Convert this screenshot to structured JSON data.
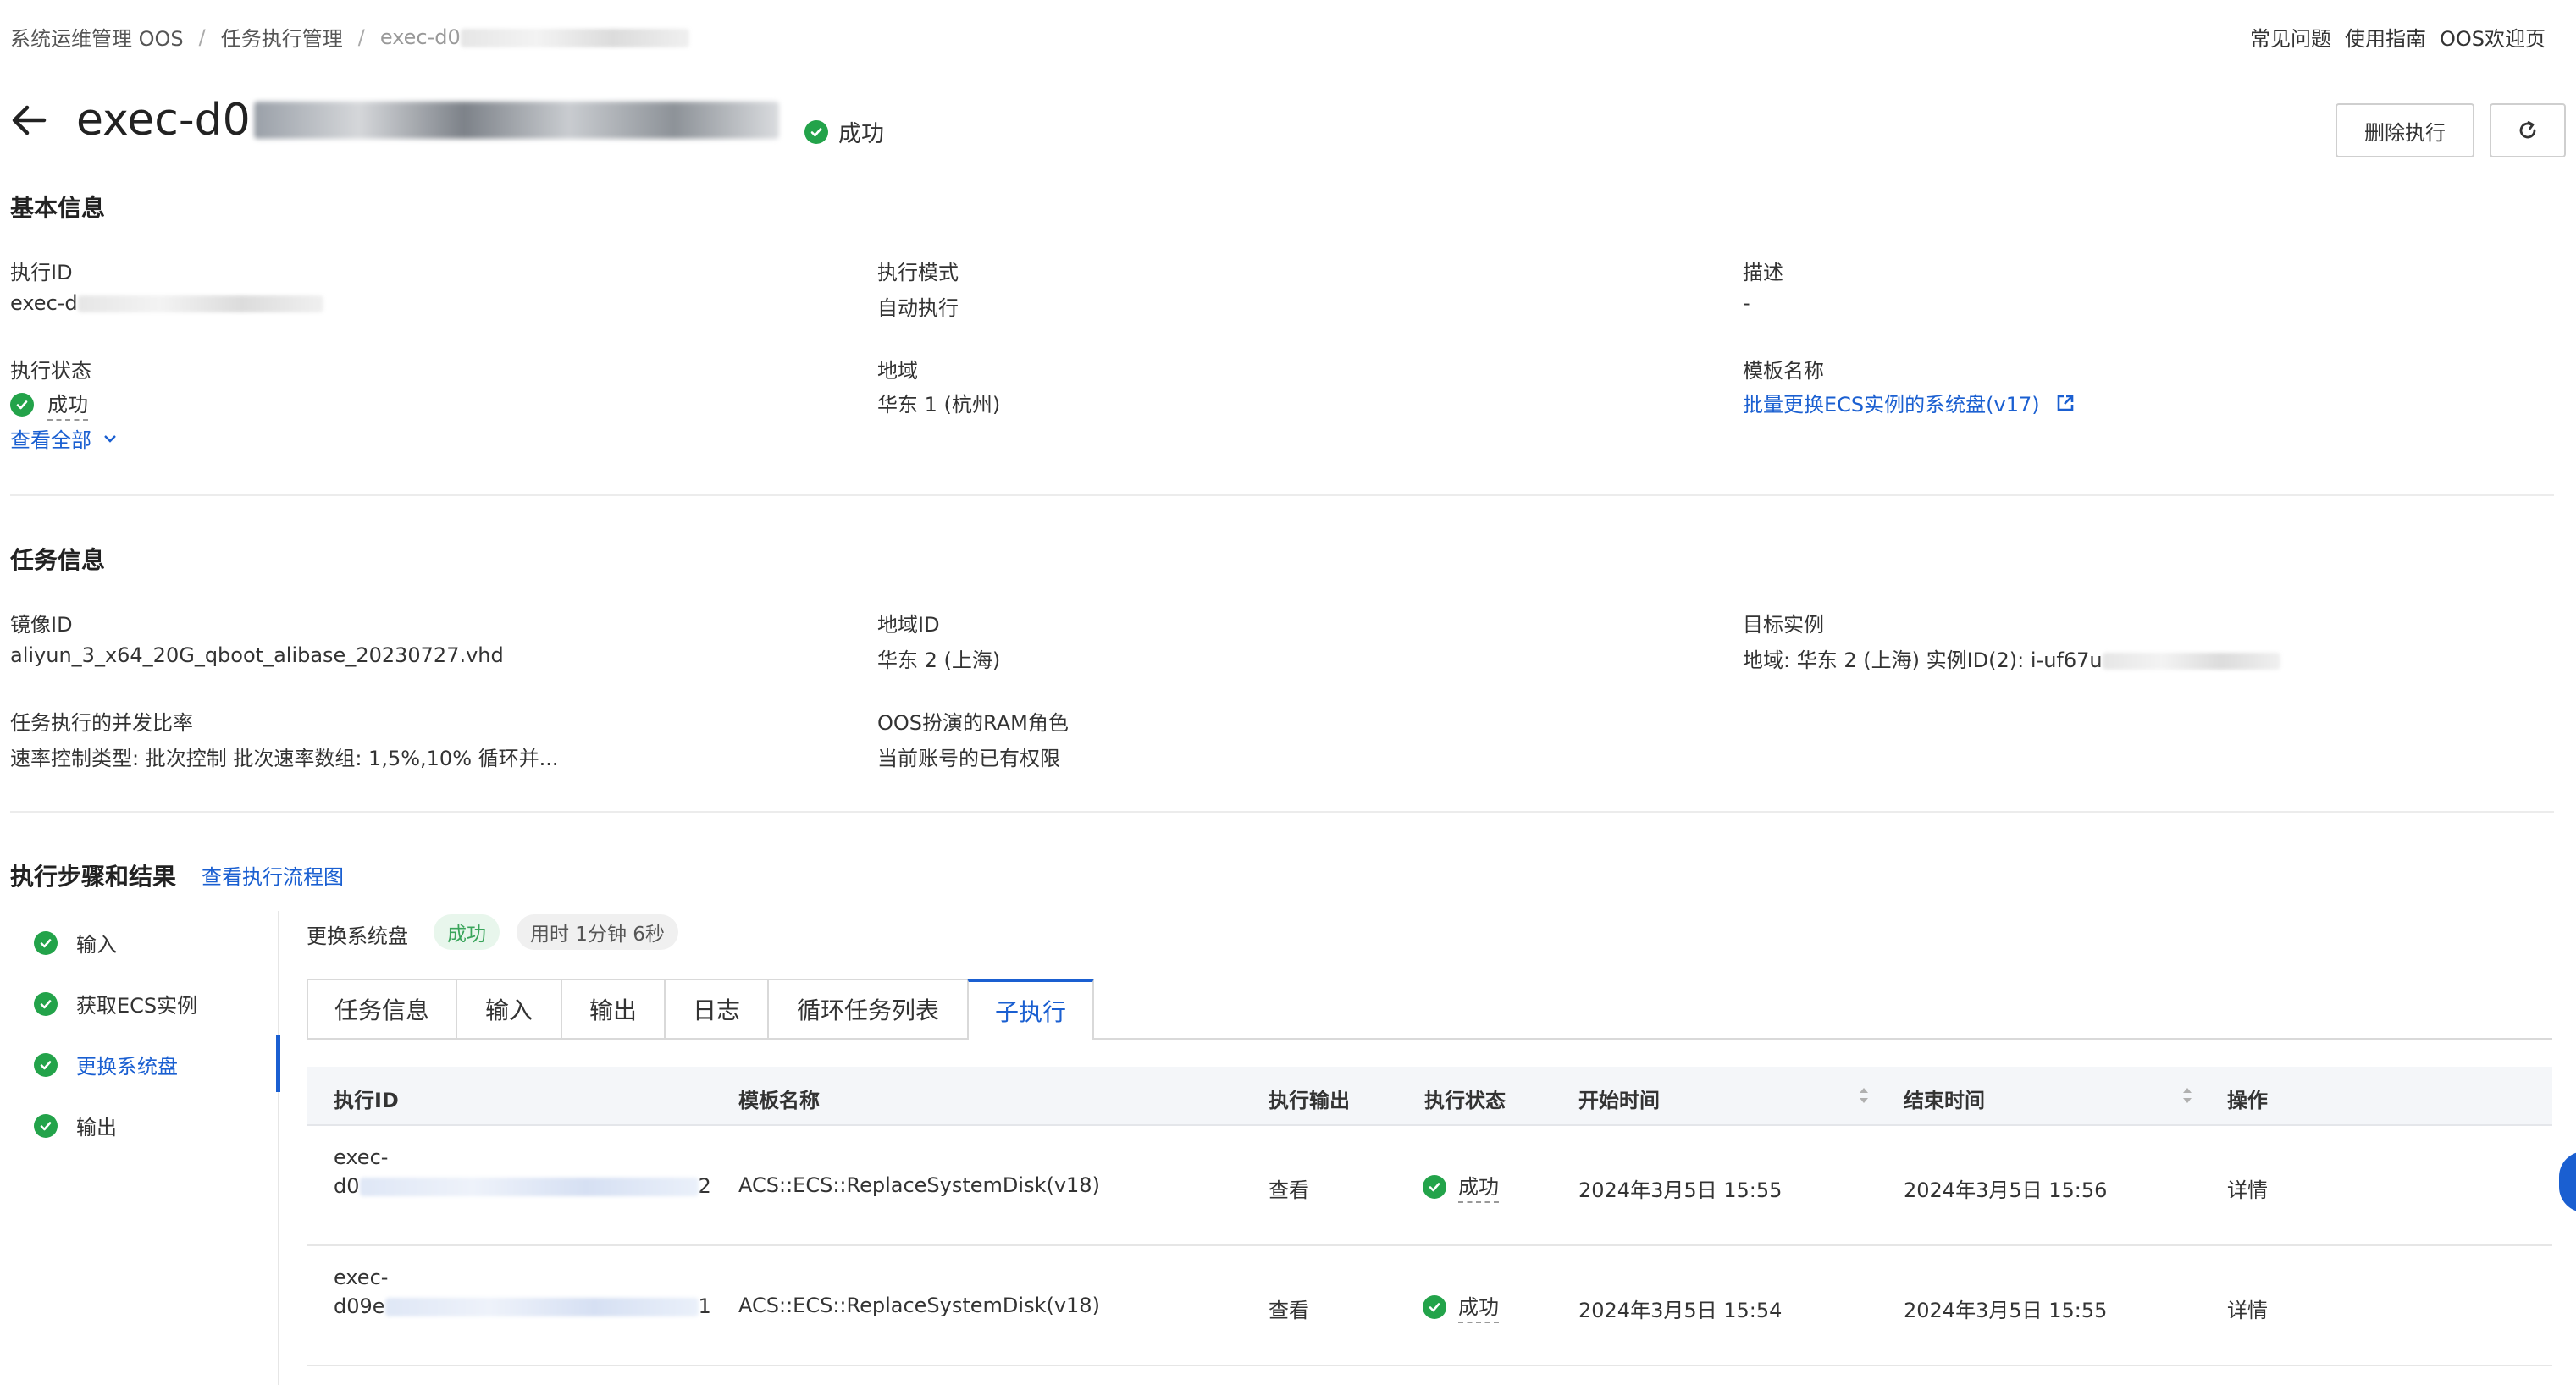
{
  "breadcrumb": {
    "items": [
      "系统运维管理 OOS",
      "任务执行管理",
      "exec-d0"
    ],
    "separator": "/"
  },
  "top_links": [
    "常见问题",
    "使用指南",
    "OOS欢迎页"
  ],
  "header": {
    "exec_prefix": "exec-d0",
    "status": "成功",
    "delete_button": "删除执行"
  },
  "basic_info": {
    "title": "基本信息",
    "exec_id_label": "执行ID",
    "exec_id_value": "exec-d",
    "mode_label": "执行模式",
    "mode_value": "自动执行",
    "desc_label": "描述",
    "desc_value": "-",
    "status_label": "执行状态",
    "status_value": "成功",
    "region_label": "地域",
    "region_value": "华东 1 (杭州)",
    "template_label": "模板名称",
    "template_value": "批量更换ECS实例的系统盘(v17)",
    "view_all": "查看全部"
  },
  "task_info": {
    "title": "任务信息",
    "image_label": "镜像ID",
    "image_value": "aliyun_3_x64_20G_qboot_alibase_20230727.vhd",
    "region_id_label": "地域ID",
    "region_id_value": "华东 2 (上海)",
    "target_label": "目标实例",
    "target_value": "地域: 华东 2 (上海) 实例ID(2): i-uf67u",
    "rate_label": "任务执行的并发比率",
    "rate_value": "速率控制类型: 批次控制 批次速率数组: 1,5%,10% 循环并...",
    "ram_label": "OOS扮演的RAM角色",
    "ram_value": "当前账号的已有权限"
  },
  "steps": {
    "title": "执行步骤和结果",
    "flow_link": "查看执行流程图",
    "items": [
      "输入",
      "获取ECS实例",
      "更换系统盘",
      "输出"
    ],
    "active_index": 2,
    "current_name": "更换系统盘",
    "current_status": "成功",
    "current_duration": "用时 1分钟 6秒"
  },
  "tabs": {
    "items": [
      "任务信息",
      "输入",
      "输出",
      "日志",
      "循环任务列表",
      "子执行"
    ],
    "active_index": 5
  },
  "table": {
    "headers": [
      "执行ID",
      "模板名称",
      "执行输出",
      "执行状态",
      "开始时间",
      "结束时间",
      "操作"
    ],
    "rows": [
      {
        "id_line1": "exec-",
        "id_line2_start": "d0",
        "id_line2_end": "2",
        "template": "ACS::ECS::ReplaceSystemDisk(v18)",
        "output": "查看",
        "status": "成功",
        "start": "2024年3月5日 15:55",
        "end": "2024年3月5日 15:56",
        "action": "详情"
      },
      {
        "id_line1": "exec-",
        "id_line2_start": "d09e",
        "id_line2_end": "1",
        "template": "ACS::ECS::ReplaceSystemDisk(v18)",
        "output": "查看",
        "status": "成功",
        "start": "2024年3月5日 15:54",
        "end": "2024年3月5日 15:55",
        "action": "详情"
      }
    ]
  },
  "colors": {
    "accent": "#1a5fd1",
    "success": "#23a34a",
    "success_tag_bg": "#e8f6ec"
  }
}
